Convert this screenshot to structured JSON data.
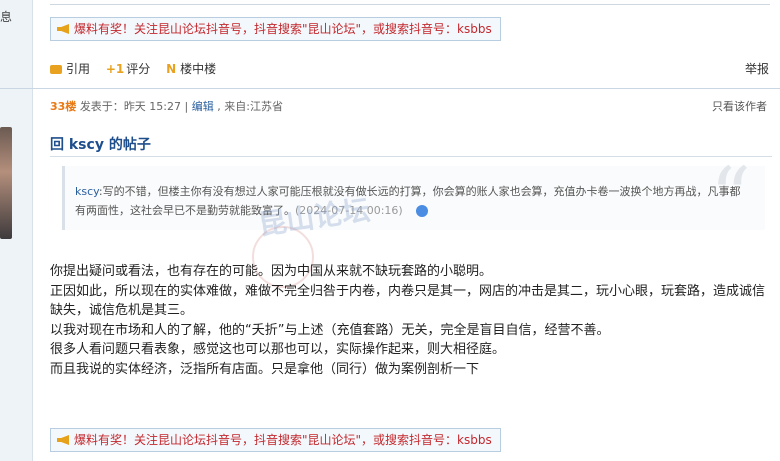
{
  "sidebar": {
    "info_char": "息"
  },
  "ad_banner": {
    "text": "爆料有奖！关注昆山论坛抖音号，抖音搜索\"昆山论坛\"，或搜索抖音号：ksbbs"
  },
  "actions": {
    "quote": "引用",
    "rate": "评分",
    "in_floor": "楼中楼",
    "report": "举报"
  },
  "post": {
    "floor": "33楼",
    "posted_prefix": "发表于：",
    "posted_time": "昨天 15:27",
    "separator": "|",
    "edit": "编辑",
    "source": "来自:江苏省",
    "only_author": "只看该作者",
    "title": "回 kscy 的帖子",
    "quote_author": "kscy",
    "quote_text": ":写的不错，但楼主你有没有想过人家可能压根就没有做长远的打算，你会算的账人家也会算，充值办卡卷一波换个地方再战，凡事都有两面性，这社会早已不是勤劳就能致富了。",
    "quote_date": "(2024-07-14 00:16)",
    "body": [
      "你提出疑问或看法，也有存在的可能。因为中国从来就不缺玩套路的小聪明。",
      "正因如此，所以现在的实体难做，难做不完全归咎于内卷，内卷只是其一，网店的冲击是其二，玩小心眼，玩套路，造成诚信缺失，诚信危机是其三。",
      "以我对现在市场和人的了解，他的“夭折”与上述（充值套路）无关，完全是盲目自信，经营不善。",
      "很多人看问题只看表象，感觉这也可以那也可以，实际操作起来，则大相径庭。",
      "而且我说的实体经济，泛指所有店面。只是拿他（同行）做为案例剖析一下"
    ],
    "watermark": "昆山论坛",
    "quote_glyph": "“"
  }
}
